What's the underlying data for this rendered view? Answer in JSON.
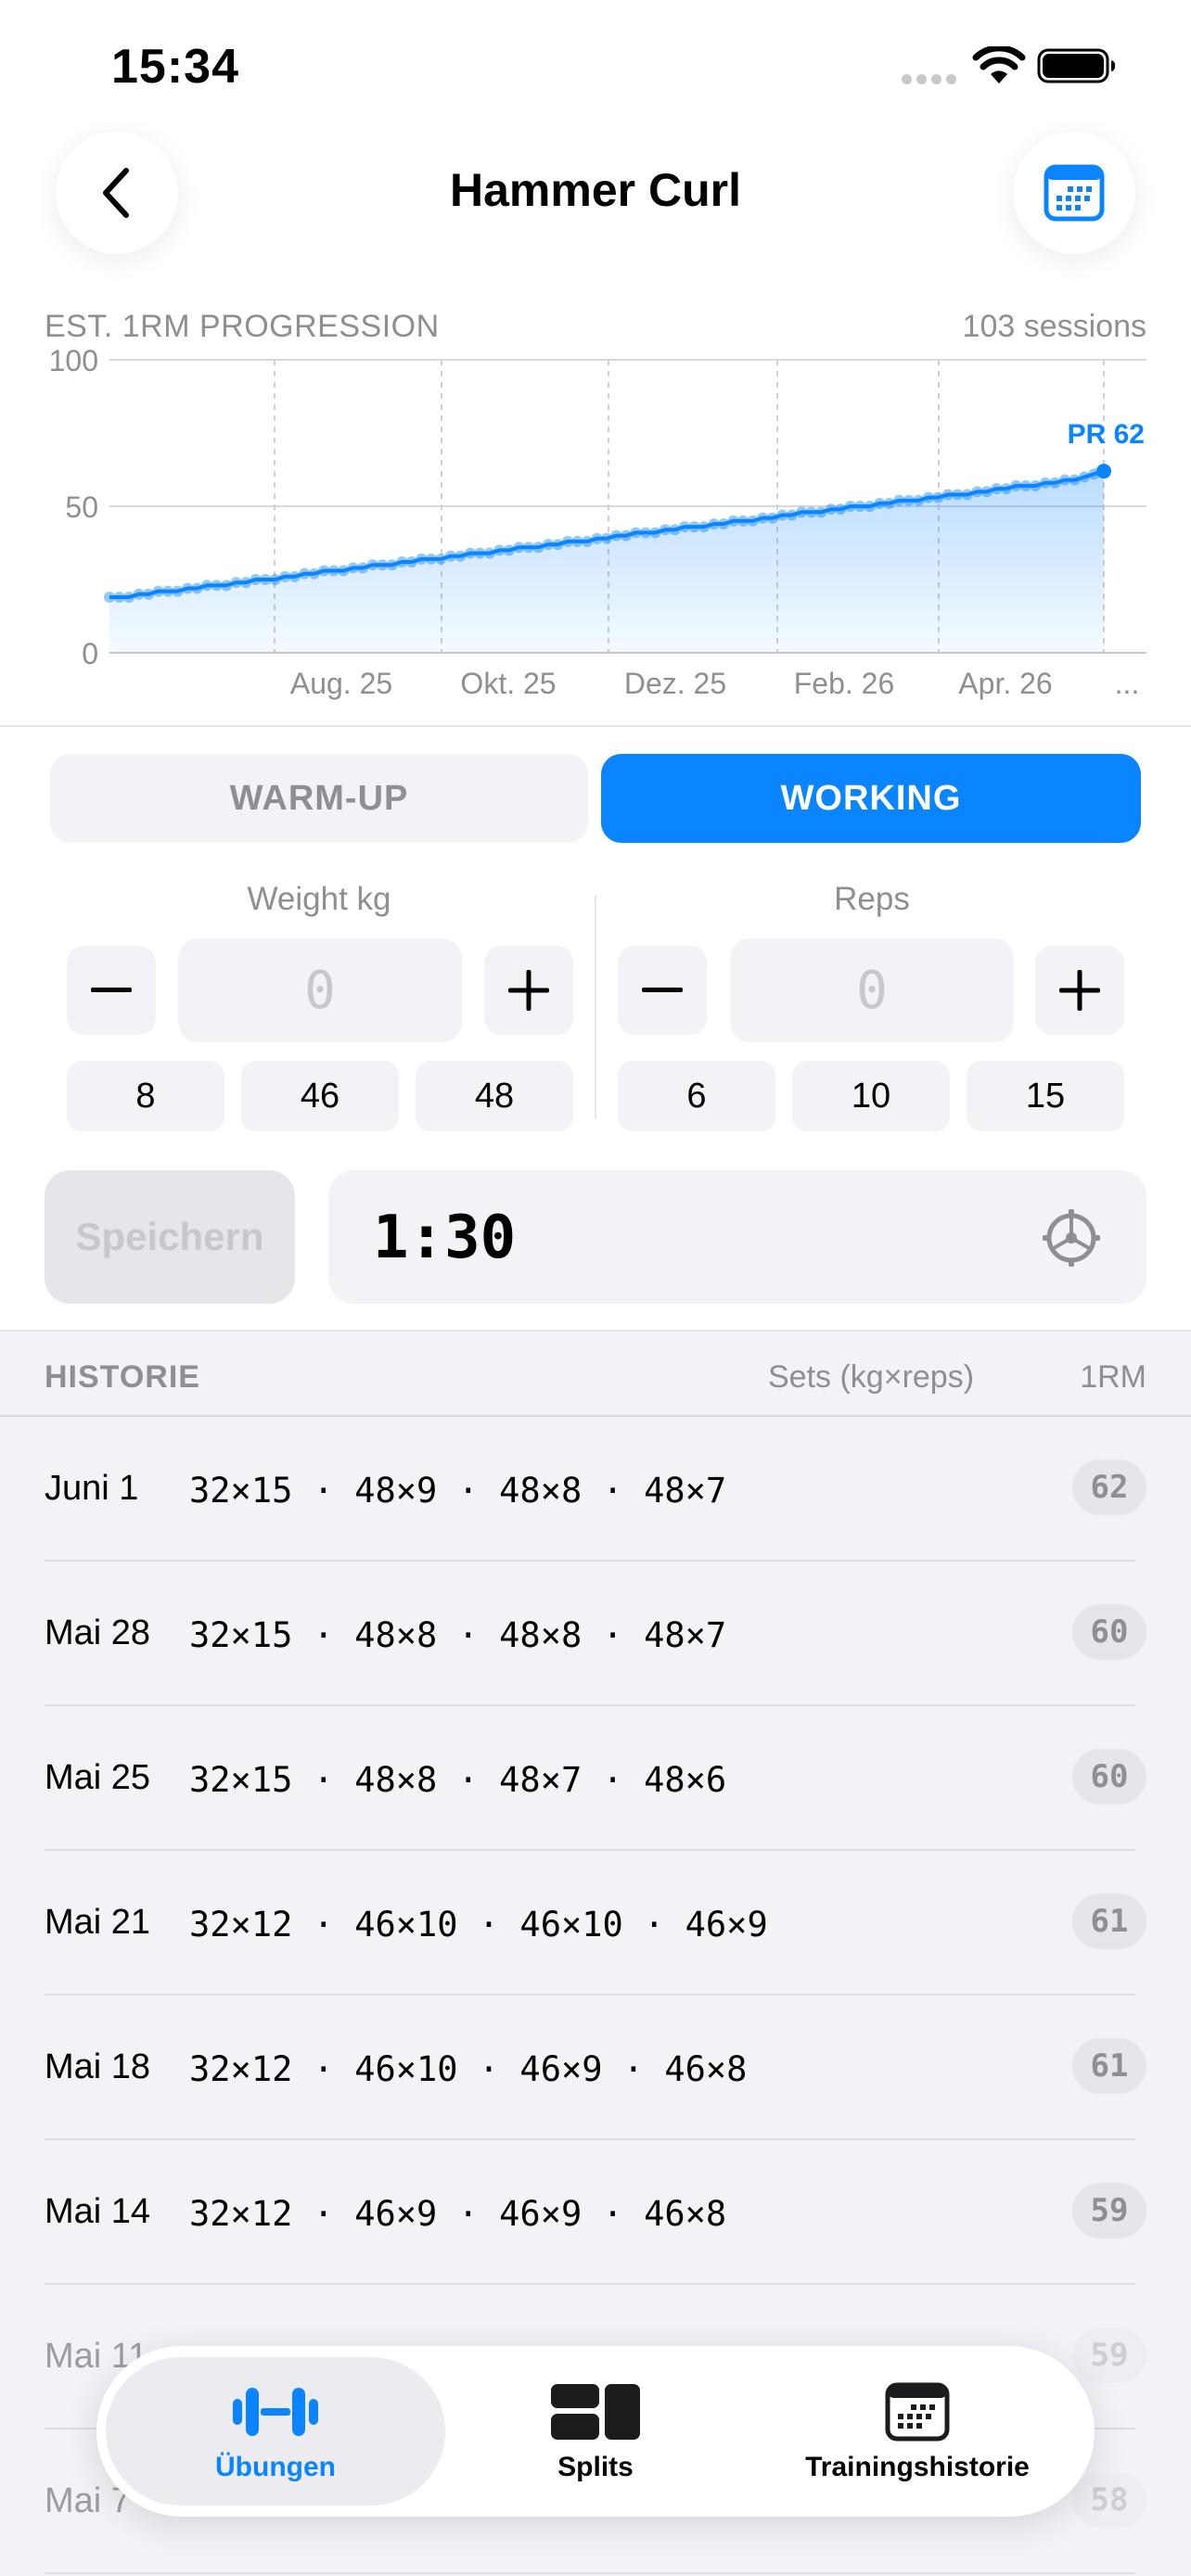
{
  "status_bar": {
    "time": "15:34"
  },
  "header": {
    "title": "Hammer Curl"
  },
  "chart_header": {
    "label": "EST. 1RM PROGRESSION",
    "sessions": "103 sessions"
  },
  "chart_data": {
    "type": "area",
    "y_ticks": [
      "100",
      "50",
      "0"
    ],
    "x_ticks": [
      "Aug. 25",
      "Okt. 25",
      "Dez. 25",
      "Feb. 26",
      "Apr. 26",
      "..."
    ],
    "ylim": [
      0,
      100
    ],
    "pr_label": "PR 62",
    "values": [
      19,
      19,
      19,
      20,
      20,
      21,
      21,
      21,
      22,
      22,
      23,
      23,
      23,
      24,
      24,
      25,
      25,
      25,
      26,
      26,
      27,
      27,
      28,
      28,
      28,
      29,
      29,
      30,
      30,
      30,
      31,
      31,
      32,
      32,
      32,
      33,
      33,
      34,
      34,
      34,
      35,
      35,
      36,
      36,
      36,
      37,
      37,
      38,
      38,
      38,
      39,
      39,
      40,
      40,
      41,
      41,
      41,
      42,
      42,
      43,
      43,
      43,
      44,
      44,
      45,
      45,
      45,
      46,
      46,
      47,
      47,
      48,
      48,
      48,
      49,
      49,
      50,
      50,
      50,
      51,
      51,
      52,
      52,
      52,
      53,
      53,
      54,
      54,
      54,
      55,
      55,
      56,
      56,
      57,
      57,
      57,
      58,
      58,
      59,
      59,
      60,
      61,
      62
    ],
    "accent_color": "#0a84ff",
    "grid": true
  },
  "segmented": {
    "warmup": "WARM-UP",
    "working": "WORKING",
    "selected": "WORKING"
  },
  "weight": {
    "label": "Weight kg",
    "value": "0",
    "presets": [
      "8",
      "46",
      "48"
    ]
  },
  "reps": {
    "label": "Reps",
    "value": "0",
    "presets": [
      "6",
      "10",
      "15"
    ]
  },
  "save_label": "Speichern",
  "timer": {
    "value": "1:30"
  },
  "history": {
    "title": "HISTORIE",
    "col_sets": "Sets (kg×reps)",
    "col_1rm": "1RM",
    "rows": [
      {
        "date": "Juni 1",
        "sets": "32×15 · 48×9 · 48×8 · 48×7",
        "rm": "62"
      },
      {
        "date": "Mai 28",
        "sets": "32×15 · 48×8 · 48×8 · 48×7",
        "rm": "60"
      },
      {
        "date": "Mai 25",
        "sets": "32×15 · 48×8 · 48×7 · 48×6",
        "rm": "60"
      },
      {
        "date": "Mai 21",
        "sets": "32×12 · 46×10 · 46×10 · 46×9",
        "rm": "61"
      },
      {
        "date": "Mai 18",
        "sets": "32×12 · 46×10 · 46×9 · 46×8",
        "rm": "61"
      },
      {
        "date": "Mai 14",
        "sets": "32×12 · 46×9 · 46×9 · 46×8",
        "rm": "59"
      },
      {
        "date": "Mai 11",
        "sets": "",
        "rm": "59"
      },
      {
        "date": "Mai 7",
        "sets": "",
        "rm": "58"
      }
    ]
  },
  "tabbar": {
    "tabs": [
      {
        "label": "Übungen",
        "icon": "dumbbell-icon",
        "active": true
      },
      {
        "label": "Splits",
        "icon": "splits-icon",
        "active": false
      },
      {
        "label": "Trainingshistorie",
        "icon": "calendar-icon",
        "active": false
      }
    ]
  }
}
